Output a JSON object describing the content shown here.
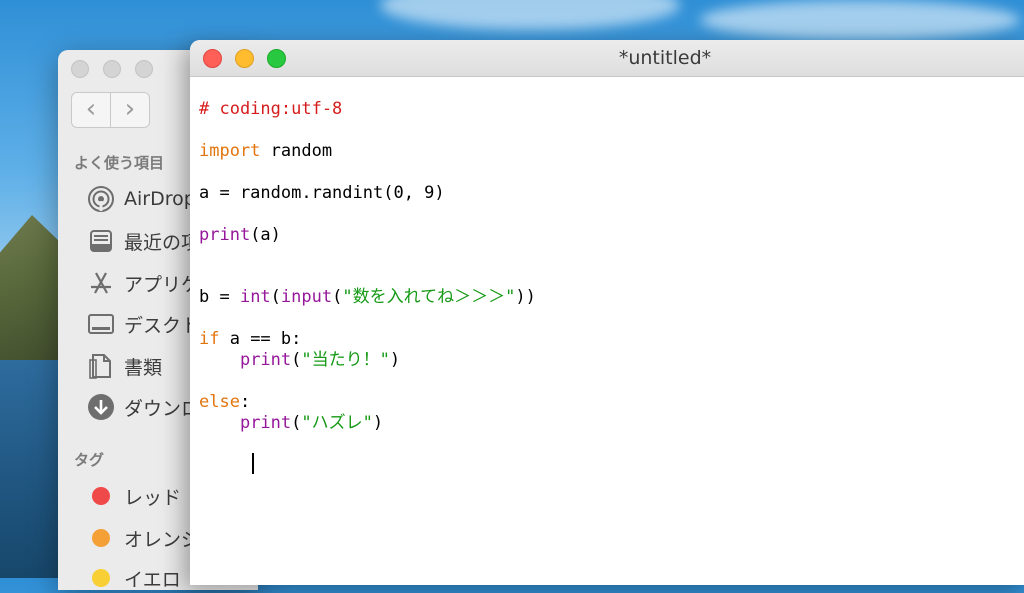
{
  "finder": {
    "section_favorites": "よく使う項目",
    "items": [
      {
        "label": "AirDrop",
        "icon": "airdrop-icon"
      },
      {
        "label": "最近の項",
        "icon": "recents-icon"
      },
      {
        "label": "アプリケ",
        "icon": "applications-icon"
      },
      {
        "label": "デスクト",
        "icon": "desktop-icon"
      },
      {
        "label": "書類",
        "icon": "documents-icon"
      },
      {
        "label": "ダウンロ",
        "icon": "downloads-icon"
      }
    ],
    "section_tags": "タグ",
    "tags": [
      {
        "label": "レッド",
        "color": "#f0494a"
      },
      {
        "label": "オレンジ",
        "color": "#f5a037"
      },
      {
        "label": "イエロ",
        "color": "#f9cf36"
      }
    ]
  },
  "editor": {
    "title": "*untitled*",
    "lines": {
      "l1": "# coding:utf-8",
      "l2_kw": "import",
      "l2_rest": " random",
      "l3": "a = random.randint(0, 9)",
      "l4_fn": "print",
      "l4_rest": "(a)",
      "l5_a": "b = ",
      "l5_int": "int",
      "l5_p1": "(",
      "l5_input": "input",
      "l5_p2": "(",
      "l5_str": "\"数を入れてね＞＞＞\"",
      "l5_end": "))",
      "l6_kw": "if",
      "l6_rest": " a == b:",
      "l7_indent": "    ",
      "l7_fn": "print",
      "l7_p": "(",
      "l7_str": "\"当たり！\"",
      "l7_end": ")",
      "l8_kw": "else",
      "l8_rest": ":",
      "l9_indent": "    ",
      "l9_fn": "print",
      "l9_p": "(",
      "l9_str": "\"ハズレ\"",
      "l9_end": ")"
    }
  }
}
